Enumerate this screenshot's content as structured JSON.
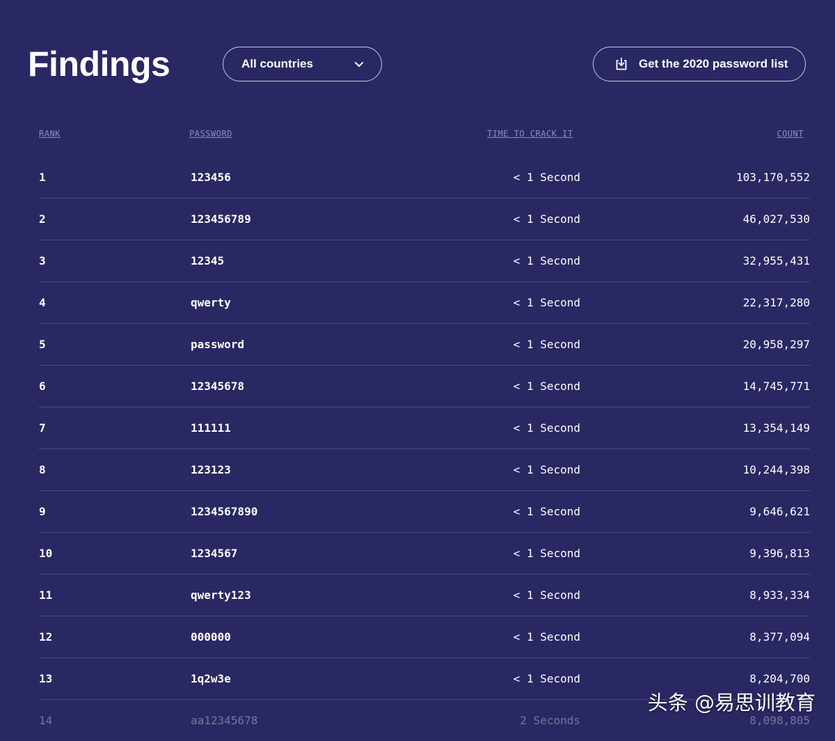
{
  "header": {
    "title": "Findings",
    "country_select": "All countries",
    "download_button": "Get the 2020 password list"
  },
  "table": {
    "columns": [
      "RANK",
      "PASSWORD",
      "TIME TO CRACK IT",
      "COUNT"
    ],
    "rows": [
      {
        "rank": "1",
        "password": "123456",
        "time": "< 1 Second",
        "count": "103,170,552"
      },
      {
        "rank": "2",
        "password": "123456789",
        "time": "< 1 Second",
        "count": "46,027,530"
      },
      {
        "rank": "3",
        "password": "12345",
        "time": "< 1 Second",
        "count": "32,955,431"
      },
      {
        "rank": "4",
        "password": "qwerty",
        "time": "< 1 Second",
        "count": "22,317,280"
      },
      {
        "rank": "5",
        "password": "password",
        "time": "< 1 Second",
        "count": "20,958,297"
      },
      {
        "rank": "6",
        "password": "12345678",
        "time": "< 1 Second",
        "count": "14,745,771"
      },
      {
        "rank": "7",
        "password": "111111",
        "time": "< 1 Second",
        "count": "13,354,149"
      },
      {
        "rank": "8",
        "password": "123123",
        "time": "< 1 Second",
        "count": "10,244,398"
      },
      {
        "rank": "9",
        "password": "1234567890",
        "time": "< 1 Second",
        "count": "9,646,621"
      },
      {
        "rank": "10",
        "password": "1234567",
        "time": "< 1 Second",
        "count": "9,396,813"
      },
      {
        "rank": "11",
        "password": "qwerty123",
        "time": "< 1 Second",
        "count": "8,933,334"
      },
      {
        "rank": "12",
        "password": "000000",
        "time": "< 1 Second",
        "count": "8,377,094"
      },
      {
        "rank": "13",
        "password": "1q2w3e",
        "time": "< 1 Second",
        "count": "8,204,700"
      },
      {
        "rank": "14",
        "password": "aa12345678",
        "time": "2 Seconds",
        "count": "8,098,805"
      }
    ]
  },
  "watermark": "头条 @易思训教育",
  "colors": {
    "background": "#2a2863",
    "header_text": "#8f8cb8",
    "text": "#ffffff"
  },
  "icons": {
    "select": "chevron-down-icon",
    "download": "download-icon"
  }
}
